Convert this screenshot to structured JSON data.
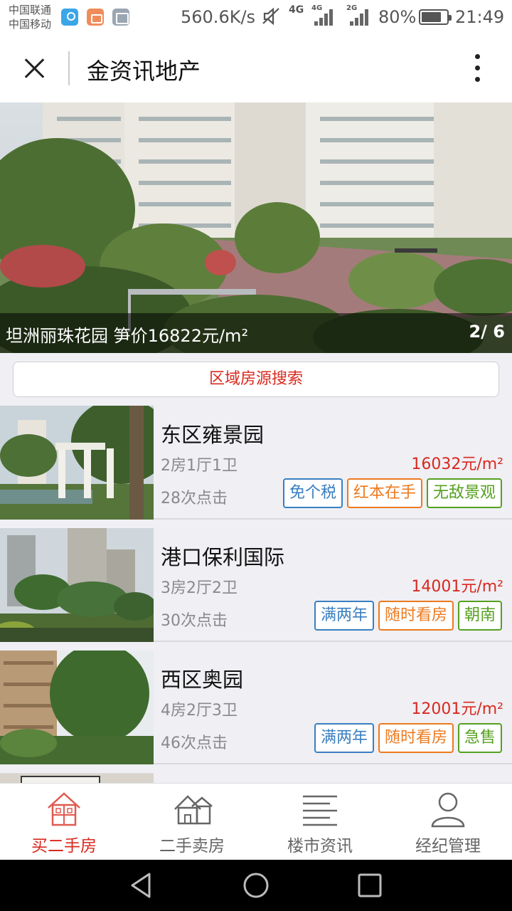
{
  "status_bar": {
    "carrier_1": "中国联通",
    "carrier_2": "中国移动",
    "net_speed": "560.6K/s",
    "network_1": "4G",
    "network_1_sub": "4G",
    "network_2": "2G",
    "battery_percent": "80%",
    "battery_level": 0.8,
    "time": "21:49",
    "icons": [
      "map-pin-icon",
      "bag-icon",
      "gallery-icon",
      "mute-icon"
    ]
  },
  "header": {
    "title": "金资讯地产",
    "close_icon": "close-icon",
    "more_icon": "more-vertical-icon"
  },
  "banner": {
    "caption": "坦洲丽珠花园 笋价16822元/m²",
    "page": "2/ 6"
  },
  "search": {
    "label": "区域房源搜索"
  },
  "listings": [
    {
      "name": "东区雍景园",
      "layout": "2房1厅1卫",
      "price": "16032元/m²",
      "clicks": "28次点击",
      "tags": [
        {
          "text": "免个税",
          "color": "#3a7fc0"
        },
        {
          "text": "红本在手",
          "color": "#ec7a1e"
        },
        {
          "text": "无敌景观",
          "color": "#56a020"
        }
      ]
    },
    {
      "name": "港口保利国际",
      "layout": "3房2厅2卫",
      "price": "14001元/m²",
      "clicks": "30次点击",
      "tags": [
        {
          "text": "满两年",
          "color": "#3a7fc0"
        },
        {
          "text": "随时看房",
          "color": "#ec7a1e"
        },
        {
          "text": "朝南",
          "color": "#56a020"
        }
      ]
    },
    {
      "name": "西区奥园",
      "layout": "4房2厅3卫",
      "price": "12001元/m²",
      "clicks": "46次点击",
      "tags": [
        {
          "text": "满两年",
          "color": "#3a7fc0"
        },
        {
          "text": "随时看房",
          "color": "#ec7a1e"
        },
        {
          "text": "急售",
          "color": "#56a020"
        }
      ]
    }
  ],
  "tabs": [
    {
      "label": "买二手房",
      "icon": "house-icon",
      "active": true
    },
    {
      "label": "二手卖房",
      "icon": "houses-icon",
      "active": false
    },
    {
      "label": "楼市资讯",
      "icon": "news-lines-icon",
      "active": false
    },
    {
      "label": "经纪管理",
      "icon": "user-icon",
      "active": false
    }
  ],
  "colors": {
    "accent_red": "#d9281e",
    "tag_blue": "#3a7fc0",
    "tag_orange": "#ec7a1e",
    "tag_green": "#56a020"
  }
}
